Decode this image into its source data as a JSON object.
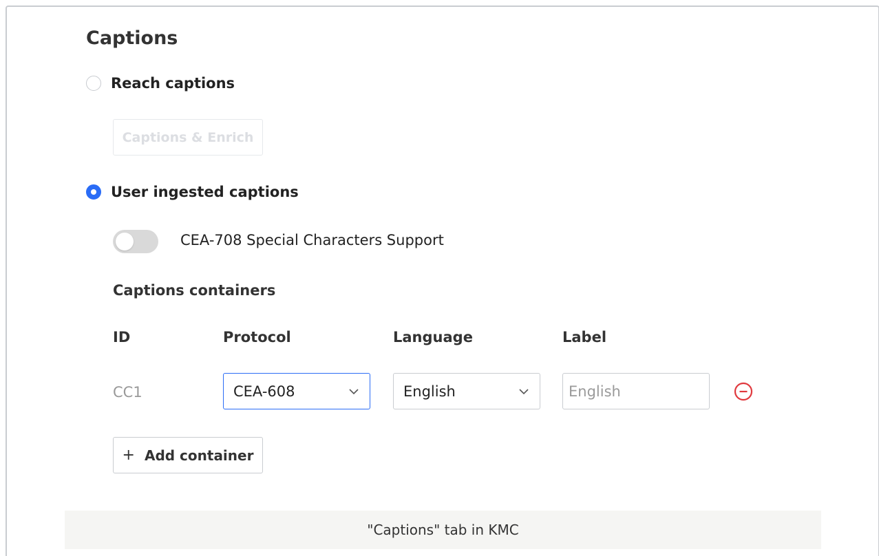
{
  "section": {
    "title": "Captions"
  },
  "reach": {
    "radio_label": "Reach captions",
    "button_label": "Captions & Enrich",
    "selected": false
  },
  "user_ingested": {
    "radio_label": "User ingested captions",
    "selected": true
  },
  "cea708": {
    "label": "CEA-708 Special Characters Support",
    "enabled": false
  },
  "containers": {
    "title": "Captions containers",
    "headers": {
      "id": "ID",
      "protocol": "Protocol",
      "language": "Language",
      "label": "Label"
    },
    "rows": [
      {
        "id": "CC1",
        "protocol": "CEA-608",
        "language": "English",
        "label_placeholder": "English"
      }
    ],
    "add_label": "Add container",
    "add_icon": "+"
  },
  "caption": "\"Captions\" tab in KMC",
  "colors": {
    "accent": "#2a6cf6",
    "danger": "#e0393e",
    "disabled_text": "#dcdee2"
  },
  "icons": {
    "remove": "minus-circle-icon",
    "chevron": "chevron-down-icon"
  }
}
